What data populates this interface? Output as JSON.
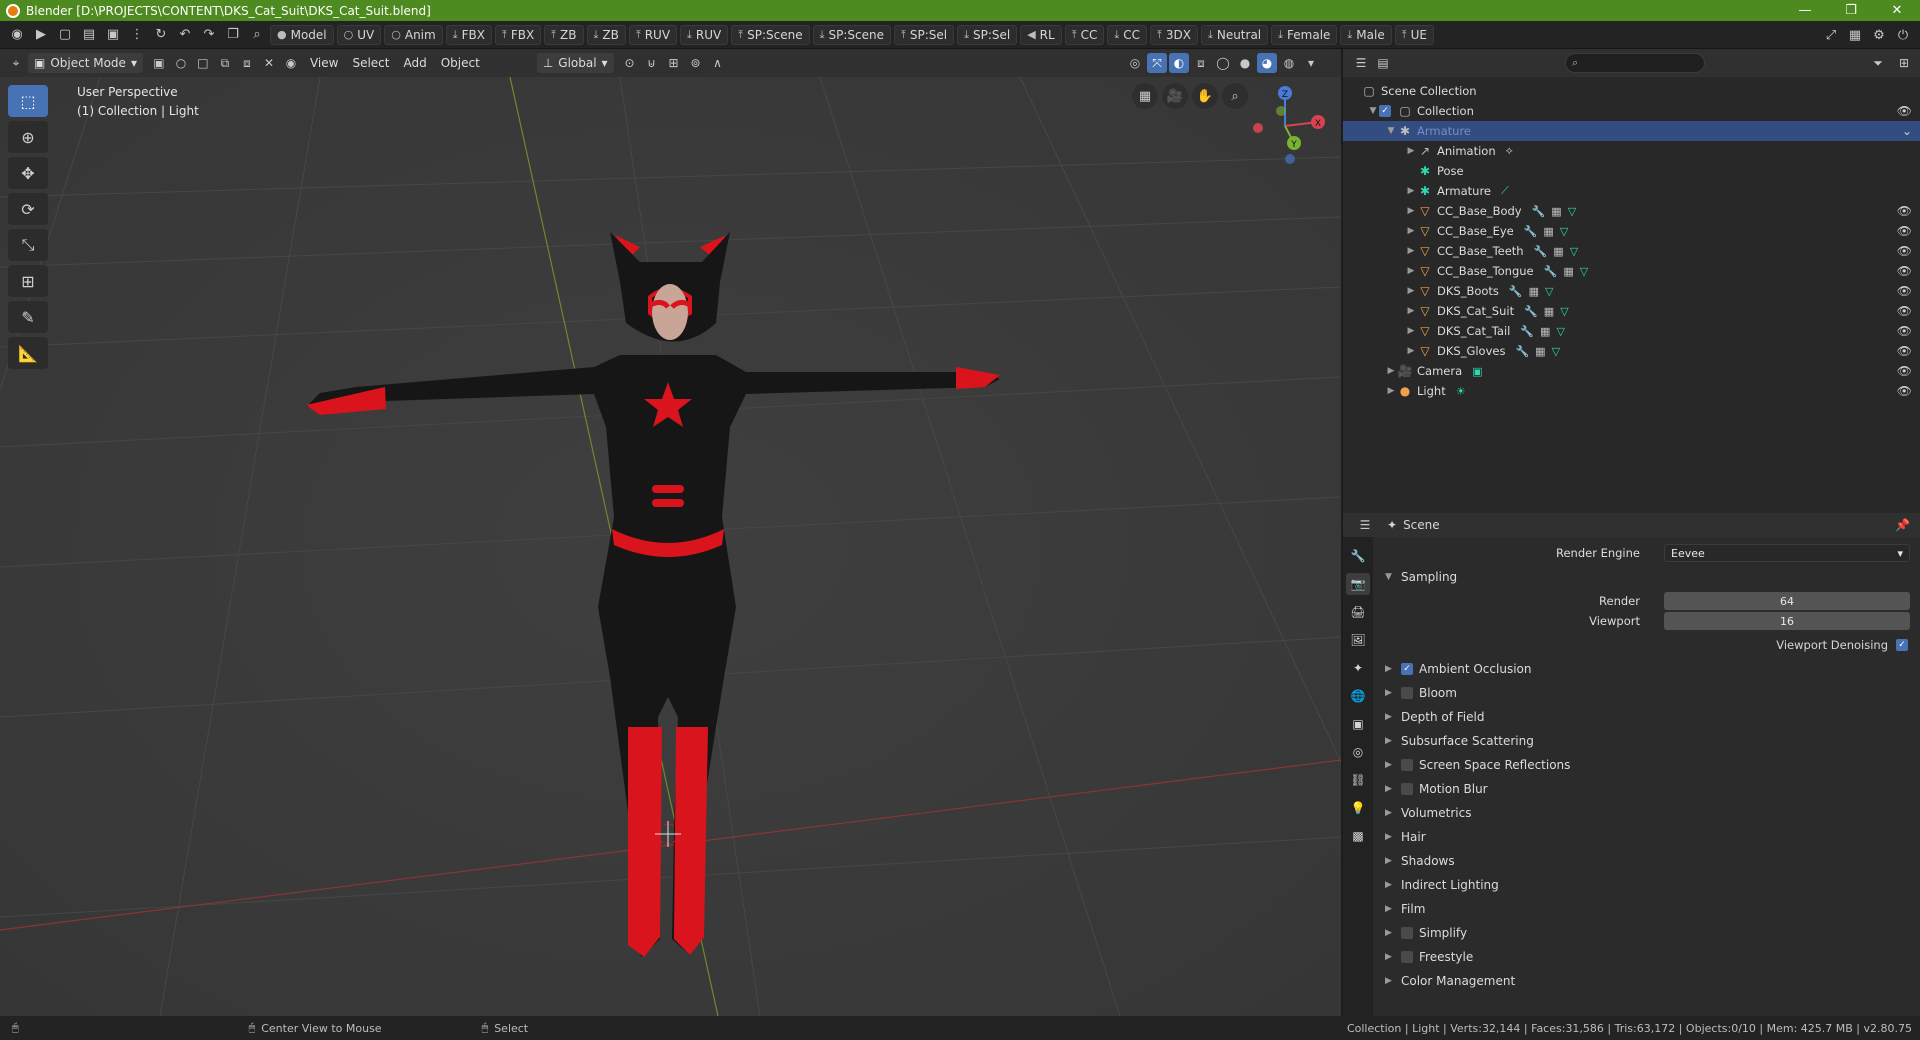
{
  "window": {
    "title": "Blender [D:\\PROJECTS\\CONTENT\\DKS_Cat_Suit\\DKS_Cat_Suit.blend]",
    "controls": [
      "—",
      "❐",
      "✕"
    ]
  },
  "topbar": {
    "buttons": [
      "Model",
      "UV",
      "Anim",
      "FBX",
      "FBX",
      "ZB",
      "ZB",
      "RUV",
      "RUV",
      "SP:Scene",
      "SP:Scene",
      "SP:Sel",
      "SP:Sel",
      "RL",
      "CC",
      "CC",
      "3DX",
      "Neutral",
      "Female",
      "Male",
      "UE"
    ]
  },
  "viewport_header": {
    "mode": "Object Mode",
    "menus": [
      "View",
      "Select",
      "Add",
      "Object"
    ],
    "transform_orientation": "Global"
  },
  "viewport": {
    "perspective_label": "User Perspective",
    "collection_label": "(1) Collection | Light",
    "gizmo_axes": {
      "x": "X",
      "y": "Y",
      "z": "Z"
    }
  },
  "outliner": {
    "rows": [
      {
        "label": "Scene Collection",
        "indent": 0
      },
      {
        "label": "Collection",
        "indent": 1
      },
      {
        "label": "Armature",
        "indent": 2,
        "selected": true
      },
      {
        "label": "Animation",
        "indent": 3
      },
      {
        "label": "Pose",
        "indent": 3
      },
      {
        "label": "Armature",
        "indent": 3
      },
      {
        "label": "CC_Base_Body",
        "indent": 3
      },
      {
        "label": "CC_Base_Eye",
        "indent": 3
      },
      {
        "label": "CC_Base_Teeth",
        "indent": 3
      },
      {
        "label": "CC_Base_Tongue",
        "indent": 3
      },
      {
        "label": "DKS_Boots",
        "indent": 3
      },
      {
        "label": "DKS_Cat_Suit",
        "indent": 3
      },
      {
        "label": "DKS_Cat_Tail",
        "indent": 3
      },
      {
        "label": "DKS_Gloves",
        "indent": 3
      },
      {
        "label": "Camera",
        "indent": 2
      },
      {
        "label": "Light",
        "indent": 2
      }
    ]
  },
  "properties": {
    "context": "Scene",
    "render_engine_label": "Render Engine",
    "render_engine": "Eevee",
    "sampling": {
      "title": "Sampling",
      "render_label": "Render",
      "render_value": "64",
      "viewport_label": "Viewport",
      "viewport_value": "16",
      "denoise_label": "Viewport Denoising"
    },
    "panels": [
      {
        "label": "Ambient Occlusion",
        "checkbox": true,
        "checked": true
      },
      {
        "label": "Bloom",
        "checkbox": true,
        "checked": false
      },
      {
        "label": "Depth of Field",
        "checkbox": false
      },
      {
        "label": "Subsurface Scattering",
        "checkbox": false
      },
      {
        "label": "Screen Space Reflections",
        "checkbox": true,
        "checked": false
      },
      {
        "label": "Motion Blur",
        "checkbox": true,
        "checked": false
      },
      {
        "label": "Volumetrics",
        "checkbox": false
      },
      {
        "label": "Hair",
        "checkbox": false
      },
      {
        "label": "Shadows",
        "checkbox": false
      },
      {
        "label": "Indirect Lighting",
        "checkbox": false
      },
      {
        "label": "Film",
        "checkbox": false
      },
      {
        "label": "Simplify",
        "checkbox": true,
        "checked": false
      },
      {
        "label": "Freestyle",
        "checkbox": true,
        "checked": false
      },
      {
        "label": "Color Management",
        "checkbox": false
      }
    ]
  },
  "statusbar": {
    "hint1": "Center View to Mouse",
    "hint2": "Select",
    "stats": "Collection | Light | Verts:32,144 | Faces:31,586 | Tris:63,172 | Objects:0/10 | Mem: 425.7 MB | v2.80.75"
  },
  "colors": {
    "titlebar": "#4d8a1f",
    "accent": "#4772b3",
    "selected_row": "#334d80",
    "suit_red": "#d9141c",
    "suit_black": "#161616"
  }
}
